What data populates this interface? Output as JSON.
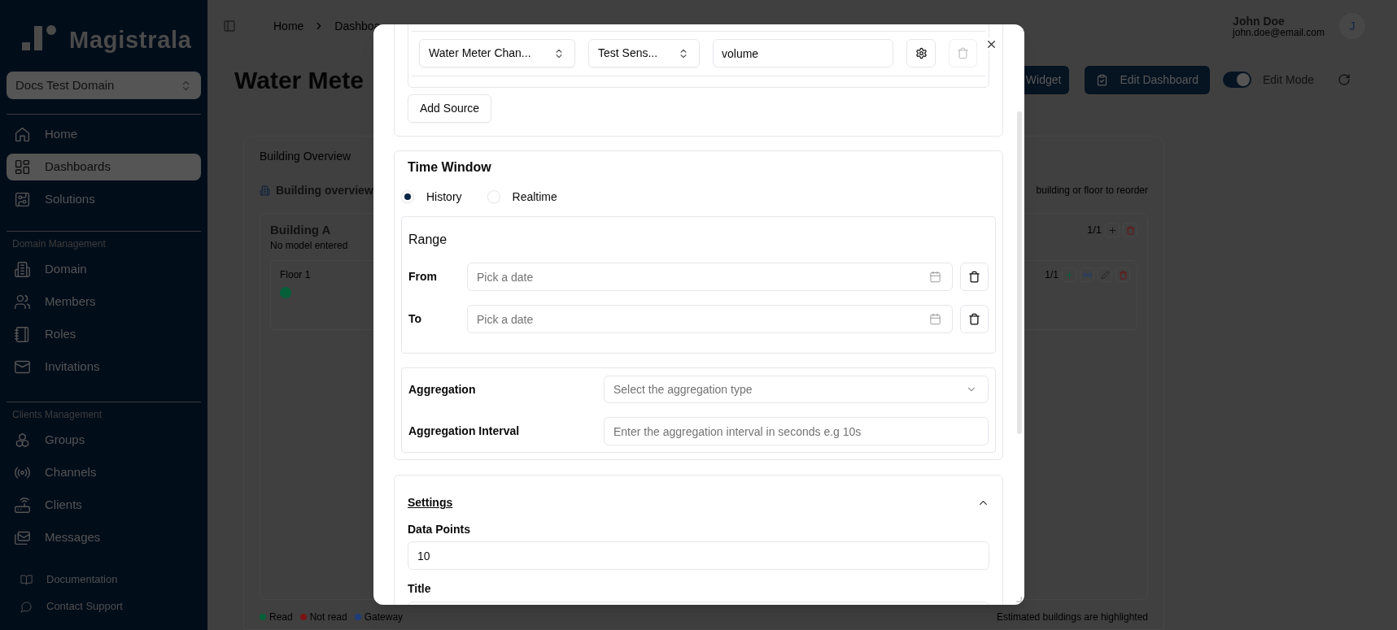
{
  "sidebar": {
    "logo": "Magistrala",
    "domain": "Docs Test Domain",
    "items": [
      {
        "label": "Home",
        "selected": false
      },
      {
        "label": "Dashboards",
        "selected": true
      },
      {
        "label": "Solutions",
        "selected": false
      }
    ],
    "sections": [
      {
        "title": "Domain Management",
        "items": [
          {
            "label": "Domain",
            "selected": false
          },
          {
            "label": "Members",
            "selected": false
          },
          {
            "label": "Roles",
            "selected": false
          },
          {
            "label": "Invitations",
            "selected": false
          }
        ]
      },
      {
        "title": "Clients Management",
        "items": [
          {
            "label": "Groups",
            "selected": false
          },
          {
            "label": "Channels",
            "selected": false
          },
          {
            "label": "Clients",
            "selected": false
          },
          {
            "label": "Messages",
            "selected": false
          }
        ]
      }
    ],
    "footer_links": [
      "Documentation",
      "Contact Support"
    ]
  },
  "header": {
    "breadcrumb": [
      "Home",
      "Dashboa"
    ],
    "user": {
      "name": "John Doe",
      "email": "john.doe@email.com",
      "initial": "J"
    }
  },
  "page": {
    "title": "Water Mete",
    "buttons": [
      "Widget",
      "Edit Dashboard"
    ],
    "edit_mode": {
      "label": "Edit Mode",
      "on": true
    }
  },
  "card": {
    "title": "Building Overview",
    "subtitle": "Building overview",
    "hint": "building or floor to reorder",
    "building": {
      "name": "Building A",
      "model": "No model entered",
      "counter": "1/1",
      "floors": [
        {
          "name": "Floor 1",
          "counter": "1/1",
          "sensors": [
            {
              "color": "#05603a"
            }
          ]
        }
      ]
    },
    "legend": [
      {
        "label": "Read",
        "color": "#05603a"
      },
      {
        "label": "Not read",
        "color": "#7a1414"
      },
      {
        "label": "Gateway",
        "color": "#1f3d7a"
      }
    ],
    "footnote": "Estimated buildings are highlighted"
  },
  "dialog": {
    "sources": [
      {
        "channel": "Water Meter Chan...",
        "sensor": "Test Sens...",
        "value": "volume",
        "delete_disabled": true
      }
    ],
    "add_source": "Add Source",
    "time_window": {
      "title": "Time Window",
      "modes": [
        {
          "label": "History",
          "selected": true
        },
        {
          "label": "Realtime",
          "selected": false
        }
      ],
      "range": {
        "title": "Range",
        "fields": [
          {
            "label": "From",
            "placeholder": "Pick a date"
          },
          {
            "label": "To",
            "placeholder": "Pick a date"
          }
        ]
      },
      "aggregation": {
        "label": "Aggregation",
        "placeholder": "Select the aggregation type"
      },
      "interval": {
        "label": "Aggregation Interval",
        "placeholder": "Enter the aggregation interval in seconds e.g 10s"
      }
    },
    "settings": {
      "title": "Settings",
      "expanded": true,
      "data_points": {
        "label": "Data Points",
        "value": "10"
      },
      "title_field": {
        "label": "Title"
      }
    }
  }
}
